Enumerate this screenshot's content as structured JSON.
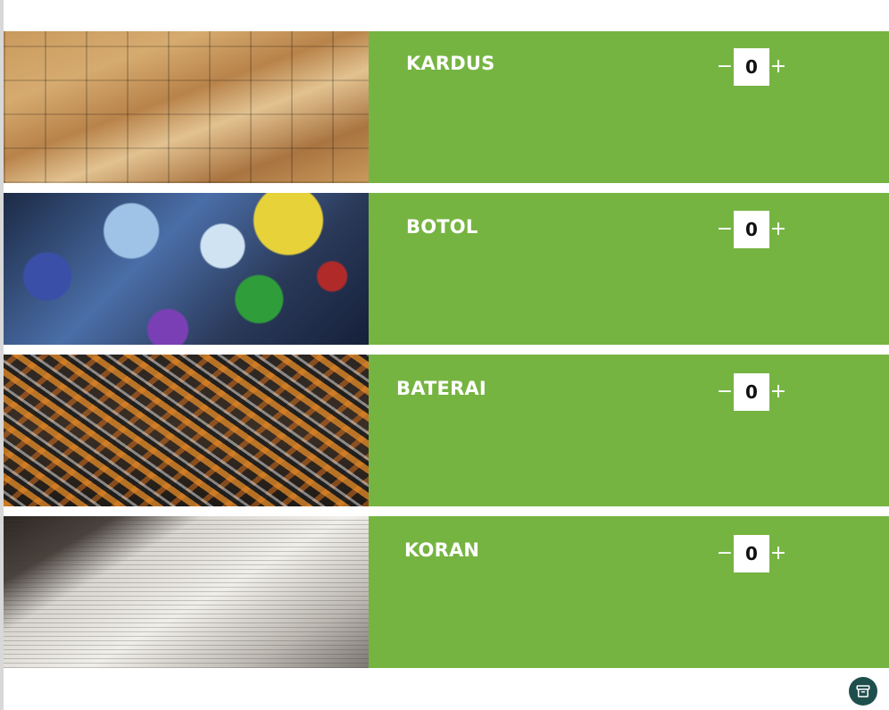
{
  "items": [
    {
      "label": "KARDUS",
      "quantity": "0",
      "minus": "−",
      "plus": "+"
    },
    {
      "label": "BOTOL",
      "quantity": "0",
      "minus": "−",
      "plus": "+"
    },
    {
      "label": "BATERAI",
      "quantity": "0",
      "minus": "−",
      "plus": "+"
    },
    {
      "label": "KORAN",
      "quantity": "0",
      "minus": "−",
      "plus": "+"
    }
  ],
  "colors": {
    "panel": "#76b442",
    "text": "#ffffff",
    "fab": "#1f4f4d"
  },
  "icons": {
    "fab": "archive-icon"
  }
}
